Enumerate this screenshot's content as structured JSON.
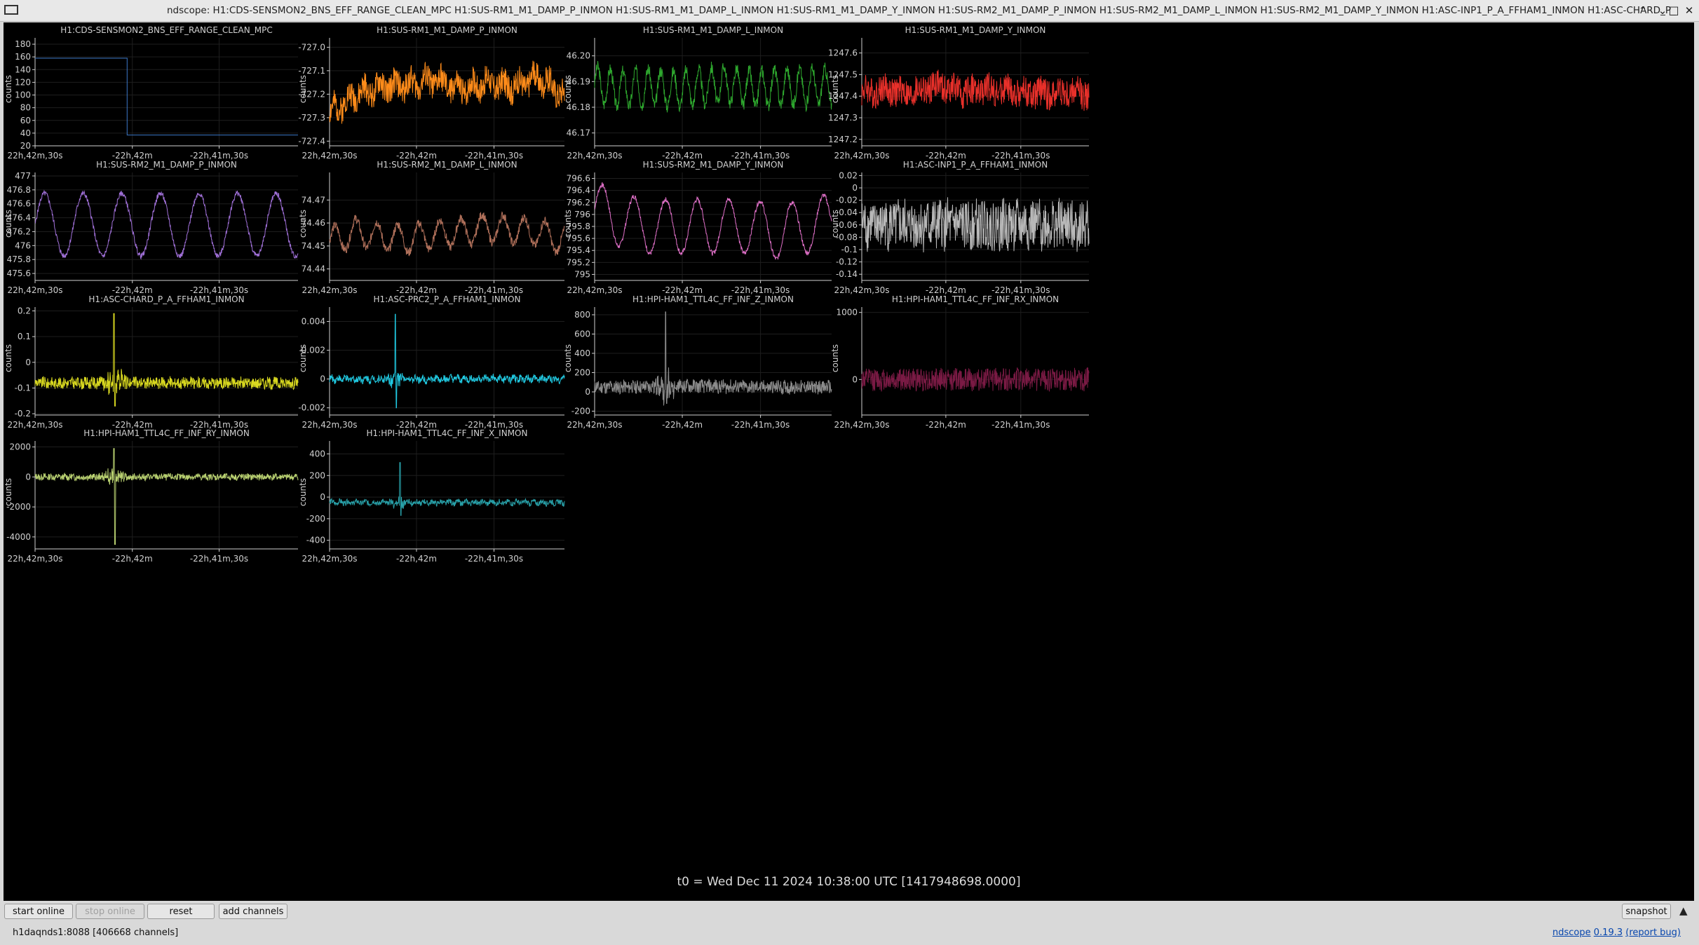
{
  "window": {
    "title": "ndscope: H1:CDS-SENSMON2_BNS_EFF_RANGE_CLEAN_MPC H1:SUS-RM1_M1_DAMP_P_INMON H1:SUS-RM1_M1_DAMP_L_INMON H1:SUS-RM1_M1_DAMP_Y_INMON H1:SUS-RM2_M1_DAMP_P_INMON H1:SUS-RM2_M1_DAMP_L_INMON H1:SUS-RM2_M1_DAMP_Y_INMON H1:ASC-INP1_P_A_FFHAM1_INMON H1:ASC-CHARD_P_",
    "minimize": "⌃",
    "restore": "⌄",
    "maximize": "□",
    "close": "✕"
  },
  "t0_label": "t0 = Wed Dec 11 2024 10:38:00 UTC [1417948698.0000]",
  "controls": {
    "start_online": "start online",
    "stop_online": "stop online",
    "reset": "reset",
    "add_channels": "add channels",
    "snapshot": "snapshot",
    "collapse_icon": "▲"
  },
  "status": {
    "server": "h1daqnds1:8088 [406668 channels]",
    "app": "ndscope",
    "version": "0.19.3",
    "report_bug": "(report bug)"
  },
  "colors": {
    "background": "#000000",
    "axis_text": "#d0d0d0",
    "grid": "#1e1e1e"
  },
  "chart_data": [
    {
      "type": "line",
      "title": "H1:CDS-SENSMON2_BNS_EFF_RANGE_CLEAN_MPC",
      "ylabel": "counts",
      "ylim": [
        20,
        190
      ],
      "yticks": [
        "20",
        "40",
        "60",
        "80",
        "100",
        "120",
        "140",
        "160",
        "180"
      ],
      "xticks": [
        "22h,42m,30s",
        "-22h,42m",
        "-22h,41m,30s"
      ],
      "color": "#3c78c8",
      "series": [
        {
          "x": [
            0,
            0.35,
            0.35,
            1
          ],
          "y": [
            158,
            158,
            37,
            37
          ]
        }
      ]
    },
    {
      "type": "line",
      "title": "H1:SUS-RM1_M1_DAMP_P_INMON",
      "ylabel": "counts",
      "ylim": [
        -727.42,
        -726.96
      ],
      "yticks": [
        "-727.4",
        "-727.3",
        "-727.2",
        "-727.1",
        "-727.0"
      ],
      "xticks": [
        "22h,42m,30s",
        "-22h,42m",
        "-22h,41m,30s"
      ],
      "color": "#ff8c1a",
      "series": [
        {
          "center": [
            -727.28,
            -727.2,
            -727.17,
            -727.16,
            -727.14,
            -727.18,
            -727.15,
            -727.17,
            -727.13,
            -727.2
          ],
          "amp": 0.06,
          "osc": 0.025,
          "period": 22,
          "seed": 2
        }
      ]
    },
    {
      "type": "line",
      "title": "H1:SUS-RM1_M1_DAMP_L_INMON",
      "ylabel": "counts",
      "ylim": [
        46.165,
        46.207
      ],
      "yticks": [
        "46.17",
        "46.18",
        "46.19",
        "46.20"
      ],
      "xticks": [
        "22h,42m,30s",
        "-22h,42m",
        "-22h,41m,30s"
      ],
      "color": "#2ea82e",
      "series": [
        {
          "center": [
            46.189,
            46.187,
            46.188,
            46.187,
            46.188,
            46.189,
            46.187,
            46.188,
            46.188,
            46.188
          ],
          "amp": 0.0025,
          "osc": 0.007,
          "period": 18,
          "seed": 3
        }
      ]
    },
    {
      "type": "line",
      "title": "H1:SUS-RM1_M1_DAMP_Y_INMON",
      "ylabel": "counts",
      "ylim": [
        1247.17,
        1247.67
      ],
      "yticks": [
        "1247.2",
        "1247.3",
        "1247.4",
        "1247.5",
        "1247.6"
      ],
      "xticks": [
        "22h,42m,30s",
        "-22h,42m",
        "-22h,41m,30s"
      ],
      "color": "#e8302a",
      "series": [
        {
          "center": [
            1247.42,
            1247.43,
            1247.41,
            1247.45,
            1247.42,
            1247.43,
            1247.42,
            1247.41,
            1247.42,
            1247.41
          ],
          "amp": 0.07,
          "osc": 0.015,
          "period": 25,
          "seed": 4
        }
      ]
    },
    {
      "type": "line",
      "title": "H1:SUS-RM2_M1_DAMP_P_INMON",
      "ylabel": "counts",
      "ylim": [
        475.5,
        477.05
      ],
      "yticks": [
        "475.6",
        "475.8",
        "476",
        "476.2",
        "476.4",
        "476.6",
        "476.8",
        "477"
      ],
      "xticks": [
        "22h,42m,30s",
        "-22h,42m",
        "-22h,41m,30s"
      ],
      "color": "#a070d8",
      "series": [
        {
          "center": [
            476.3,
            476.3,
            476.3,
            476.3,
            476.3,
            476.3,
            476.3,
            476.3,
            476.3,
            476.3
          ],
          "amp": 0.04,
          "osc": 0.45,
          "period": 55,
          "seed": 5
        }
      ]
    },
    {
      "type": "line",
      "title": "H1:SUS-RM2_M1_DAMP_L_INMON",
      "ylabel": "counts",
      "ylim": [
        74.435,
        74.482
      ],
      "yticks": [
        "74.44",
        "74.45",
        "74.46",
        "74.47"
      ],
      "xticks": [
        "22h,42m,30s",
        "-22h,42m",
        "-22h,41m,30s"
      ],
      "color": "#b0705a",
      "series": [
        {
          "center": [
            74.452,
            74.456,
            74.454,
            74.453,
            74.455,
            74.456,
            74.458,
            74.457,
            74.456,
            74.452
          ],
          "amp": 0.002,
          "osc": 0.006,
          "period": 30,
          "seed": 6
        }
      ]
    },
    {
      "type": "line",
      "title": "H1:SUS-RM2_M1_DAMP_Y_INMON",
      "ylabel": "counts",
      "ylim": [
        794.9,
        796.7
      ],
      "yticks": [
        "795",
        "795.2",
        "795.4",
        "795.6",
        "795.8",
        "796",
        "796.2",
        "796.4",
        "796.6"
      ],
      "xticks": [
        "22h,42m,30s",
        "-22h,42m",
        "-22h,41m,30s"
      ],
      "color": "#e070c8",
      "series": [
        {
          "center": [
            796.1,
            795.9,
            795.8,
            795.8,
            795.8,
            795.8,
            795.8,
            795.7,
            795.8,
            795.9
          ],
          "amp": 0.04,
          "osc": 0.45,
          "period": 45,
          "seed": 7
        }
      ]
    },
    {
      "type": "line",
      "title": "H1:ASC-INP1_P_A_FFHAM1_INMON",
      "ylabel": "counts",
      "ylim": [
        -0.15,
        0.025
      ],
      "yticks": [
        "-0.14",
        "-0.12",
        "-0.1",
        "-0.08",
        "-0.06",
        "-0.04",
        "-0.02",
        "0",
        "0.02"
      ],
      "xticks": [
        "22h,42m,30s",
        "-22h,42m",
        "-22h,41m,30s"
      ],
      "color": "#b8b8b8",
      "series": [
        {
          "center": [
            -0.06,
            -0.06,
            -0.06,
            -0.06,
            -0.06,
            -0.06,
            -0.06,
            -0.06,
            -0.06,
            -0.06
          ],
          "amp": 0.04,
          "osc": 0.005,
          "period": 10,
          "seed": 8
        }
      ]
    },
    {
      "type": "line",
      "title": "H1:ASC-CHARD_P_A_FFHAM1_INMON",
      "ylabel": "counts",
      "ylim": [
        -0.205,
        0.215
      ],
      "yticks": [
        "-0.2",
        "-0.1",
        "0",
        "0.1",
        "0.2"
      ],
      "xticks": [
        "22h,42m,30s",
        "-22h,42m",
        "-22h,41m,30s"
      ],
      "color": "#d8d820",
      "series": [
        {
          "center": [
            -0.08,
            -0.08,
            -0.08,
            -0.08,
            -0.08,
            -0.08,
            -0.08,
            -0.08,
            -0.08,
            -0.08
          ],
          "amp": 0.022,
          "osc": 0.004,
          "period": 10,
          "seed": 9,
          "spike_at": 0.3,
          "spike_up": 0.19,
          "spike_down": -0.17
        }
      ]
    },
    {
      "type": "line",
      "title": "H1:ASC-PRC2_P_A_FFHAM1_INMON",
      "ylabel": "counts",
      "ylim": [
        -0.0025,
        0.005
      ],
      "yticks": [
        "-0.002",
        "0",
        "0.002",
        "0.004"
      ],
      "xticks": [
        "22h,42m,30s",
        "-22h,42m",
        "-22h,41m,30s"
      ],
      "color": "#20c8e0",
      "series": [
        {
          "center": [
            0,
            0,
            0,
            0,
            0,
            0,
            0,
            0,
            0,
            0
          ],
          "amp": 0.00025,
          "osc": 0.0001,
          "period": 10,
          "seed": 10,
          "spike_at": 0.28,
          "spike_up": 0.0045,
          "spike_down": -0.002
        }
      ]
    },
    {
      "type": "line",
      "title": "H1:HPI-HAM1_TTL4C_FF_INF_Z_INMON",
      "ylabel": "counts",
      "ylim": [
        -240,
        880
      ],
      "yticks": [
        "-200",
        "0",
        "200",
        "400",
        "600",
        "800"
      ],
      "xticks": [
        "22h,42m,30s",
        "-22h,42m",
        "-22h,41m,30s"
      ],
      "color": "#8c8c8c",
      "series": [
        {
          "center": [
            50,
            50,
            55,
            60,
            60,
            55,
            50,
            50,
            50,
            50
          ],
          "amp": 70,
          "osc": 10,
          "period": 10,
          "seed": 11,
          "spike_at": 0.3,
          "spike_up": 830,
          "spike_down": -120
        }
      ]
    },
    {
      "type": "line",
      "title": "H1:HPI-HAM1_TTL4C_FF_INF_RX_INMON",
      "ylabel": "counts",
      "ylim": [
        -530,
        1080
      ],
      "yticks": [
        "0",
        "1000"
      ],
      "xticks": [
        "22h,42m,30s",
        "-22h,42m",
        "-22h,41m,30s"
      ],
      "color": "#7a1a44",
      "series": [
        {
          "center": [
            0,
            0,
            0,
            0,
            0,
            0,
            0,
            0,
            0,
            0
          ],
          "amp": 170,
          "osc": 10,
          "period": 10,
          "seed": 12
        }
      ]
    },
    {
      "type": "line",
      "title": "H1:HPI-HAM1_TTL4C_FF_INF_RY_INMON",
      "ylabel": "counts",
      "ylim": [
        -4800,
        2400
      ],
      "yticks": [
        "-4000",
        "-2000",
        "0",
        "2000"
      ],
      "xticks": [
        "22h,42m,30s",
        "-22h,42m",
        "-22h,41m,30s"
      ],
      "color": "#b8d070",
      "series": [
        {
          "center": [
            0,
            0,
            0,
            0,
            0,
            0,
            0,
            0,
            0,
            0
          ],
          "amp": 220,
          "osc": 40,
          "period": 10,
          "seed": 13,
          "spike_at": 0.3,
          "spike_up": 1900,
          "spike_down": -4500
        }
      ]
    },
    {
      "type": "line",
      "title": "H1:HPI-HAM1_TTL4C_FF_INF_X_INMON",
      "ylabel": "counts",
      "ylim": [
        -480,
        520
      ],
      "yticks": [
        "-400",
        "-200",
        "0",
        "200",
        "400"
      ],
      "xticks": [
        "22h,42m,30s",
        "-22h,42m",
        "-22h,41m,30s"
      ],
      "color": "#28a0a8",
      "series": [
        {
          "center": [
            -50,
            -50,
            -50,
            -50,
            -50,
            -50,
            -50,
            -50,
            -50,
            -50
          ],
          "amp": 25,
          "osc": 12,
          "period": 12,
          "seed": 14,
          "spike_at": 0.3,
          "spike_up": 320,
          "spike_down": -170
        }
      ]
    }
  ]
}
